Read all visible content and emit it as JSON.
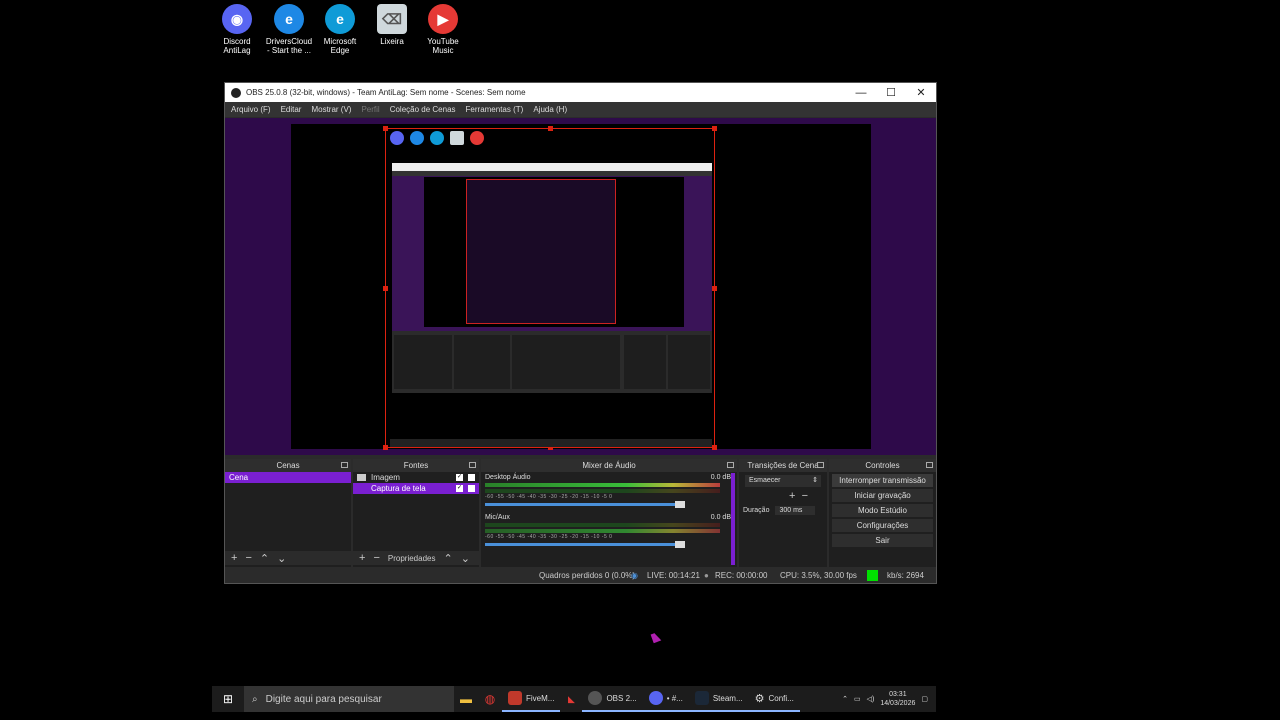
{
  "desktop": {
    "icons": [
      {
        "label": "Discord AntiLag",
        "name": "discord-antilag-icon",
        "color": "#5865f2",
        "glyph": "◉"
      },
      {
        "label": "DriversCloud - Start the ...",
        "name": "driverscloud-icon",
        "color": "#1e88e5",
        "glyph": "e"
      },
      {
        "label": "Microsoft Edge",
        "name": "edge-icon",
        "color": "#0f9bd7",
        "glyph": "e"
      },
      {
        "label": "Lixeira",
        "name": "recycle-bin-icon",
        "color": "#cfd8dc",
        "glyph": "🗑"
      },
      {
        "label": "YouTube Music",
        "name": "youtube-music-icon",
        "color": "#e53935",
        "glyph": "▶"
      }
    ]
  },
  "obs": {
    "title": "OBS 25.0.8 (32-bit, windows) - Team AntiLag: Sem nome - Scenes: Sem nome",
    "window_controls": {
      "minimize": "—",
      "maximize": "☐",
      "close": "✕"
    },
    "menu": [
      "Arquivo (F)",
      "Editar",
      "Mostrar (V)",
      "Perfil",
      "Coleção de Cenas",
      "Ferramentas (T)",
      "Ajuda (H)"
    ],
    "panels": {
      "scenes": {
        "title": "Cenas",
        "items": [
          "Cena"
        ]
      },
      "sources": {
        "title": "Fontes",
        "items": [
          "Imagem",
          "Captura de tela"
        ],
        "properties": "Propriedades"
      },
      "mixer": {
        "title": "Mixer de Áudio",
        "tracks": [
          {
            "name": "Desktop Áudio",
            "db": "0.0 dB"
          },
          {
            "name": "Mic/Aux",
            "db": "0.0 dB"
          }
        ],
        "scale": "-60 -55 -50 -45 -40 -35 -30 -25 -20 -15 -10 -5 0"
      },
      "transitions": {
        "title": "Transições de Cena",
        "type": "Esmaecer",
        "duration_label": "Duração",
        "duration_value": "300 ms"
      },
      "controls": {
        "title": "Controles",
        "buttons": [
          "Interromper transmissão",
          "Iniciar gravação",
          "Modo Estúdio",
          "Configurações",
          "Sair"
        ]
      }
    },
    "status": {
      "dropped": "Quadros perdidos 0 (0.0%)",
      "live": "LIVE: 00:14:21",
      "rec": "REC: 00:00:00",
      "cpu": "CPU: 3.5%, 30.00 fps",
      "kbps": "kb/s: 2694",
      "indicator_color": "#00e000"
    }
  },
  "taskbar": {
    "search_placeholder": "Digite aqui para pesquisar",
    "items": [
      {
        "label": "FiveM...",
        "name": "fivem-taskbar-item",
        "color": "#c0392b"
      },
      {
        "label": "OBS 2...",
        "name": "obs-taskbar-item",
        "color": "#555"
      },
      {
        "label": "• #...",
        "name": "discord-taskbar-item",
        "color": "#5865f2"
      },
      {
        "label": "Steam...",
        "name": "steam-taskbar-item",
        "color": "#1b2838"
      },
      {
        "label": "Confi...",
        "name": "settings-taskbar-item",
        "color": "#444"
      }
    ],
    "time": "03:31",
    "date": "14/03/2026"
  }
}
